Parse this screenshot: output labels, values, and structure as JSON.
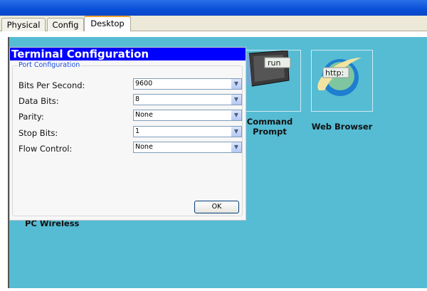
{
  "tabs": [
    {
      "label": "Physical"
    },
    {
      "label": "Config"
    },
    {
      "label": "Desktop",
      "active": true
    }
  ],
  "desktop": {
    "apps": [
      {
        "label1": "Command",
        "label2": "Prompt",
        "icon": "command-prompt-icon",
        "icon_text": "run"
      },
      {
        "label": "Web Browser",
        "icon": "web-browser-icon",
        "icon_text": "http:"
      }
    ],
    "pc_wireless": "PC Wireless"
  },
  "dialog": {
    "title": "Terminal Configuration",
    "group": "Port Configuration",
    "fields": [
      {
        "label": "Bits Per Second:",
        "value": "9600"
      },
      {
        "label": "Data Bits:",
        "value": "8"
      },
      {
        "label": "Parity:",
        "value": "None"
      },
      {
        "label": "Stop Bits:",
        "value": "1"
      },
      {
        "label": "Flow Control:",
        "value": "None"
      }
    ],
    "ok": "OK"
  }
}
